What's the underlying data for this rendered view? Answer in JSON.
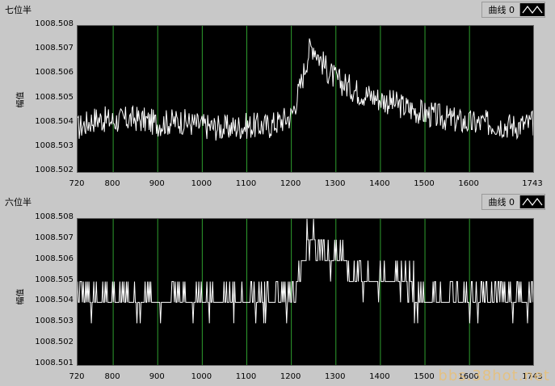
{
  "panels": [
    {
      "title": "七位半",
      "legend_label": "曲线 0",
      "legend_icon": "curve-icon",
      "ylabel": "幅值",
      "y_ticks": [
        "1008.508",
        "1008.507",
        "1008.506",
        "1008.505",
        "1008.504",
        "1008.503",
        "1008.502"
      ],
      "x_ticks": [
        "720",
        "800",
        "900",
        "1000",
        "1100",
        "1200",
        "1300",
        "1400",
        "1500",
        "1600",
        "1743"
      ]
    },
    {
      "title": "六位半",
      "legend_label": "曲线 0",
      "legend_icon": "curve-icon",
      "ylabel": "幅值",
      "y_ticks": [
        "1008.508",
        "1008.507",
        "1008.506",
        "1008.505",
        "1008.504",
        "1008.503",
        "1008.502",
        "1008.501"
      ],
      "x_ticks": [
        "720",
        "800",
        "900",
        "1000",
        "1100",
        "1200",
        "1300",
        "1400",
        "1500",
        "1600",
        "1743"
      ]
    }
  ],
  "colors": {
    "plot_bg": "#000000",
    "grid": "#2e9e2e",
    "trace": "#ffffff",
    "panel_bg": "#c8c8c8"
  },
  "watermark": "bbs.38hot.net",
  "chart_data": [
    {
      "type": "line",
      "title": "七位半",
      "xlabel": "",
      "ylabel": "幅值",
      "xlim": [
        720,
        1743
      ],
      "ylim": [
        1008.502,
        1008.508
      ],
      "grid": true,
      "x_gridlines": [
        800,
        900,
        1000,
        1100,
        1200,
        1300,
        1400,
        1500,
        1600
      ],
      "series": [
        {
          "x": [
            720,
            760,
            800,
            850,
            900,
            950,
            1000,
            1050,
            1100,
            1150,
            1200,
            1220,
            1240,
            1250,
            1260,
            1280,
            1300,
            1350,
            1400,
            1450,
            1500,
            1550,
            1600,
            1650,
            1700,
            1743
          ],
          "values": [
            1008.5038,
            1008.5042,
            1008.5041,
            1008.5042,
            1008.504,
            1008.5041,
            1008.5039,
            1008.5038,
            1008.5039,
            1008.5039,
            1008.5043,
            1008.5055,
            1008.507,
            1008.5072,
            1008.5068,
            1008.5062,
            1008.5058,
            1008.5053,
            1008.505,
            1008.5047,
            1008.5044,
            1008.5042,
            1008.504,
            1008.504,
            1008.5039,
            1008.504
          ]
        }
      ]
    },
    {
      "type": "line",
      "title": "六位半",
      "xlabel": "",
      "ylabel": "幅值",
      "xlim": [
        720,
        1743
      ],
      "ylim": [
        1008.501,
        1008.508
      ],
      "grid": true,
      "x_gridlines": [
        800,
        900,
        1000,
        1100,
        1200,
        1300,
        1400,
        1500,
        1600
      ],
      "series": [
        {
          "x": [
            720,
            760,
            800,
            850,
            900,
            950,
            1000,
            1050,
            1100,
            1150,
            1200,
            1220,
            1240,
            1250,
            1260,
            1280,
            1300,
            1350,
            1400,
            1450,
            1500,
            1550,
            1600,
            1650,
            1700,
            1743
          ],
          "values": [
            1008.504,
            1008.504,
            1008.504,
            1008.504,
            1008.504,
            1008.504,
            1008.504,
            1008.504,
            1008.504,
            1008.504,
            1008.504,
            1008.505,
            1008.507,
            1008.507,
            1008.506,
            1008.506,
            1008.506,
            1008.505,
            1008.505,
            1008.505,
            1008.504,
            1008.504,
            1008.504,
            1008.504,
            1008.504,
            1008.504
          ]
        }
      ]
    }
  ]
}
